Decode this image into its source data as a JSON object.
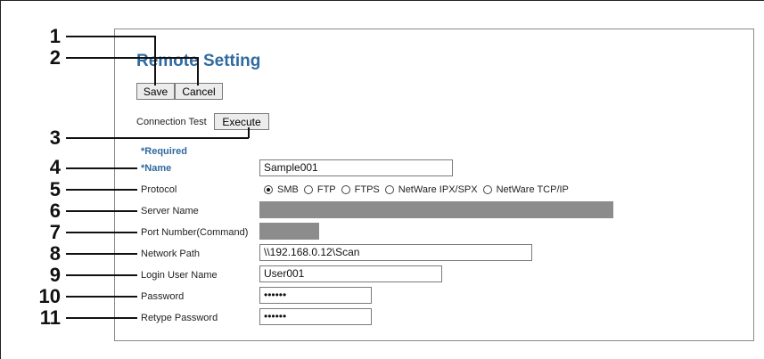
{
  "title": "Remote Setting",
  "buttons": {
    "save": "Save",
    "cancel": "Cancel",
    "execute": "Execute"
  },
  "connection_test_label": "Connection Test",
  "required_note": "*Required",
  "fields": {
    "name": {
      "label": "*Name",
      "value": "Sample001"
    },
    "protocol": {
      "label": "Protocol",
      "options": [
        "SMB",
        "FTP",
        "FTPS",
        "NetWare IPX/SPX",
        "NetWare TCP/IP"
      ],
      "selected": "SMB"
    },
    "server_name": {
      "label": "Server Name",
      "value": ""
    },
    "port_number": {
      "label": "Port Number(Command)",
      "value": ""
    },
    "network_path": {
      "label": "Network Path",
      "value": "\\\\192.168.0.12\\Scan"
    },
    "login_user_name": {
      "label": "Login User Name",
      "value": "User001"
    },
    "password": {
      "label": "Password",
      "value": "••••••"
    },
    "retype_password": {
      "label": "Retype Password",
      "value": "••••••"
    }
  },
  "callouts": [
    "1",
    "2",
    "3",
    "4",
    "5",
    "6",
    "7",
    "8",
    "9",
    "10",
    "11"
  ]
}
